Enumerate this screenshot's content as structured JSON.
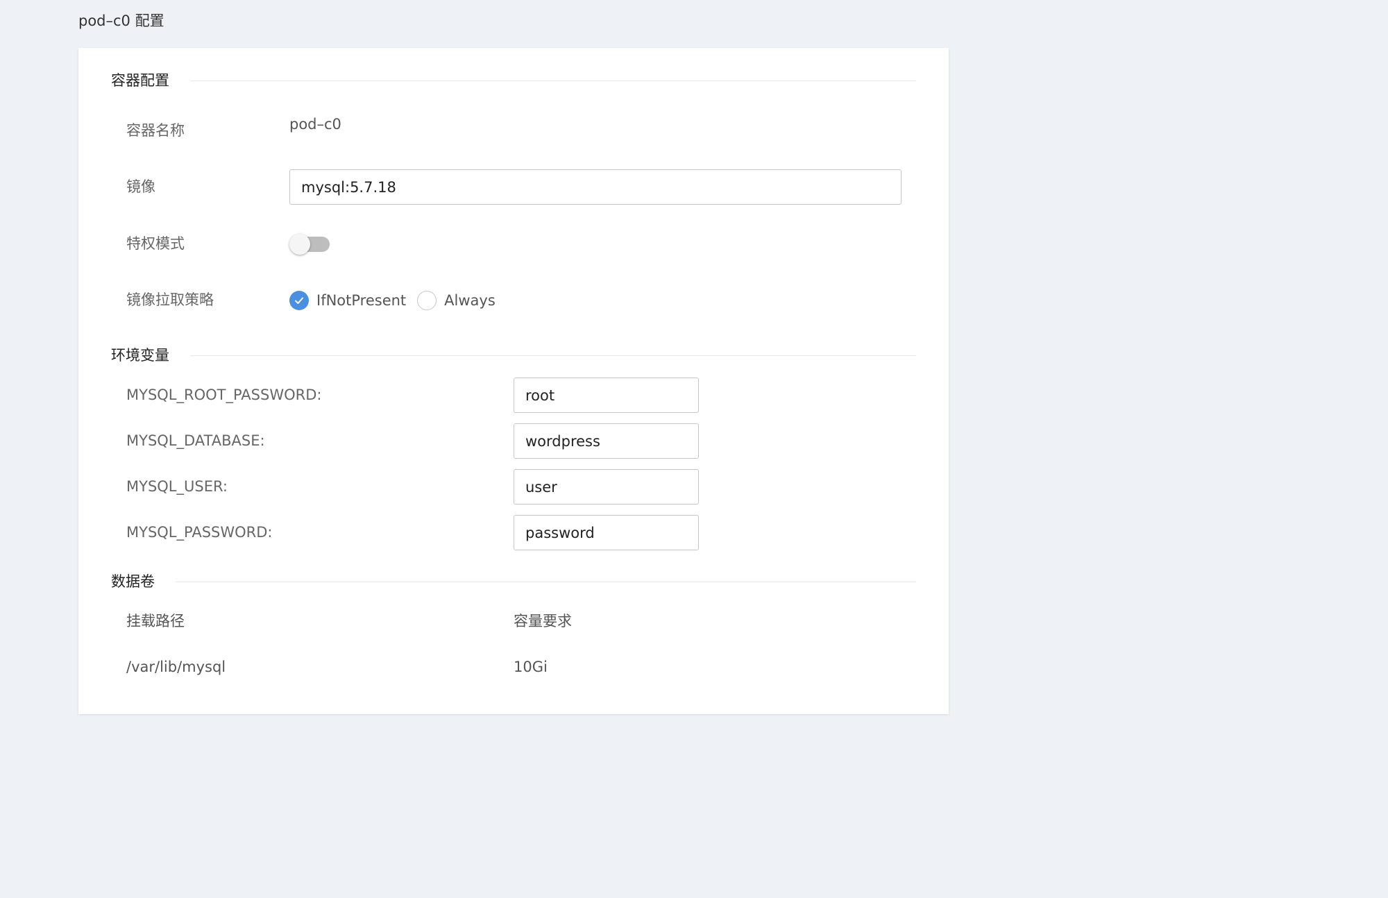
{
  "page": {
    "title": "pod–c0 配置"
  },
  "container_section": {
    "title": "容器配置",
    "name_label": "容器名称",
    "name_value": "pod–c0",
    "image_label": "镜像",
    "image_value": "mysql:5.7.18",
    "privileged_label": "特权模式",
    "privileged_enabled": false,
    "pull_policy_label": "镜像拉取策略",
    "pull_policy_options": [
      {
        "label": "IfNotPresent",
        "checked": true
      },
      {
        "label": "Always",
        "checked": false
      }
    ]
  },
  "env_section": {
    "title": "环境变量",
    "vars": [
      {
        "name": "MYSQL_ROOT_PASSWORD:",
        "value": "root"
      },
      {
        "name": "MYSQL_DATABASE:",
        "value": "wordpress"
      },
      {
        "name": "MYSQL_USER:",
        "value": "user"
      },
      {
        "name": "MYSQL_PASSWORD:",
        "value": "password"
      }
    ]
  },
  "volume_section": {
    "title": "数据卷",
    "headers": {
      "mount_path": "挂载路径",
      "capacity": "容量要求"
    },
    "rows": [
      {
        "mount_path": "/var/lib/mysql",
        "capacity": "10Gi"
      }
    ]
  },
  "colors": {
    "background": "#eef2f6",
    "accent": "#4a90e2",
    "toggle_off": "#bdbdbd"
  },
  "icons": {
    "radio_checked": "check-icon"
  }
}
